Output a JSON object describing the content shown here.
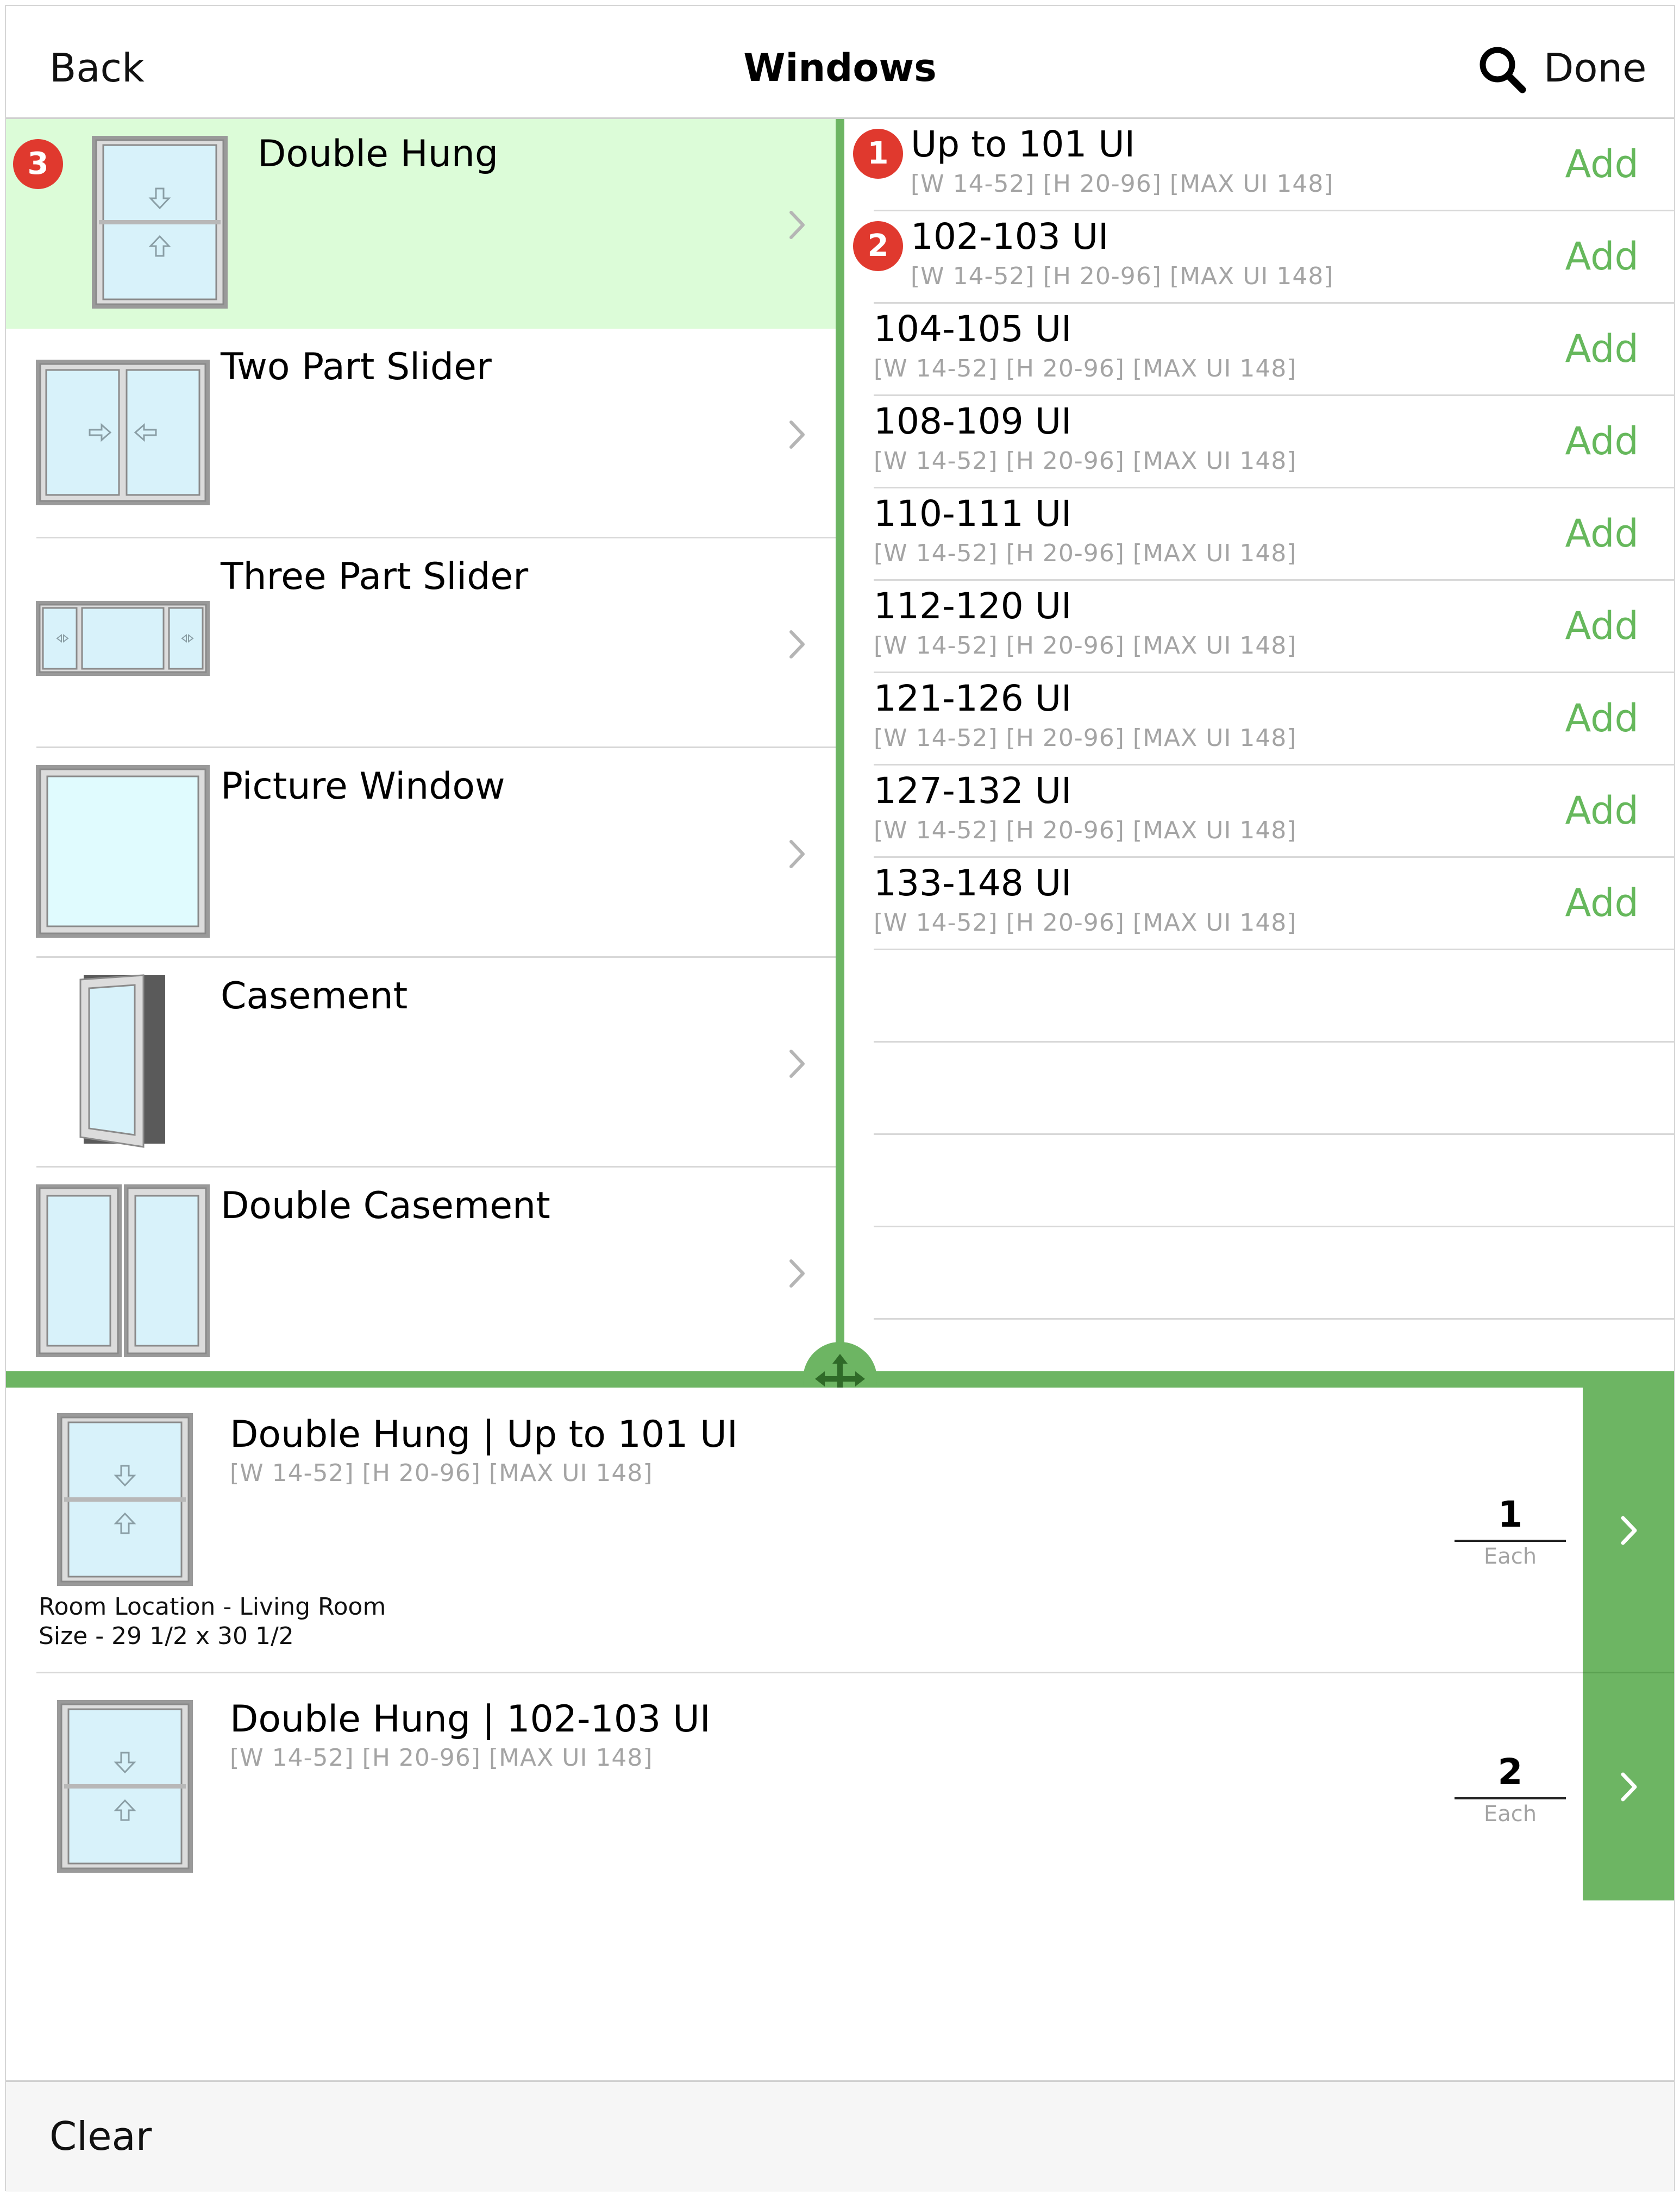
{
  "header": {
    "back_label": "Back",
    "title": "Windows",
    "done_label": "Done"
  },
  "window_types": [
    {
      "name": "Double Hung",
      "selected": true,
      "badge": "3"
    },
    {
      "name": "Two Part Slider"
    },
    {
      "name": "Three Part Slider"
    },
    {
      "name": "Picture Window"
    },
    {
      "name": "Casement"
    },
    {
      "name": "Double Casement"
    }
  ],
  "sizes": [
    {
      "name": "Up to 101 UI",
      "spec": "[W 14-52] [H 20-96] [MAX UI 148]",
      "add_label": "Add",
      "badge": "1"
    },
    {
      "name": "102-103 UI",
      "spec": "[W 14-52] [H 20-96] [MAX UI 148]",
      "add_label": "Add",
      "badge": "2"
    },
    {
      "name": "104-105 UI",
      "spec": "[W 14-52] [H 20-96] [MAX UI 148]",
      "add_label": "Add"
    },
    {
      "name": "108-109 UI",
      "spec": "[W 14-52] [H 20-96] [MAX UI 148]",
      "add_label": "Add"
    },
    {
      "name": "110-111 UI",
      "spec": "[W 14-52] [H 20-96] [MAX UI 148]",
      "add_label": "Add"
    },
    {
      "name": "112-120 UI",
      "spec": "[W 14-52] [H 20-96] [MAX UI 148]",
      "add_label": "Add"
    },
    {
      "name": "121-126 UI",
      "spec": "[W 14-52] [H 20-96] [MAX UI 148]",
      "add_label": "Add"
    },
    {
      "name": "127-132 UI",
      "spec": "[W 14-52] [H 20-96] [MAX UI 148]",
      "add_label": "Add"
    },
    {
      "name": "133-148 UI",
      "spec": "[W 14-52] [H 20-96] [MAX UI 148]",
      "add_label": "Add"
    }
  ],
  "cart": [
    {
      "title": "Double Hung | Up to 101 UI",
      "spec": "[W 14-52] [H 20-96] [MAX UI 148]",
      "notes": [
        "Room Location - Living Room",
        "Size - 29 1/2 x 30 1/2"
      ],
      "quantity": "1",
      "unit": "Each"
    },
    {
      "title": "Double Hung | 102-103 UI",
      "spec": "[W 14-52] [H 20-96] [MAX UI 148]",
      "notes": [],
      "quantity": "2",
      "unit": "Each"
    }
  ],
  "footer": {
    "clear_label": "Clear"
  },
  "colors": {
    "accent_green": "#6db563",
    "selected_row": "#dcfcd8",
    "badge_red": "#e0392e",
    "add_text": "#66b85c"
  }
}
